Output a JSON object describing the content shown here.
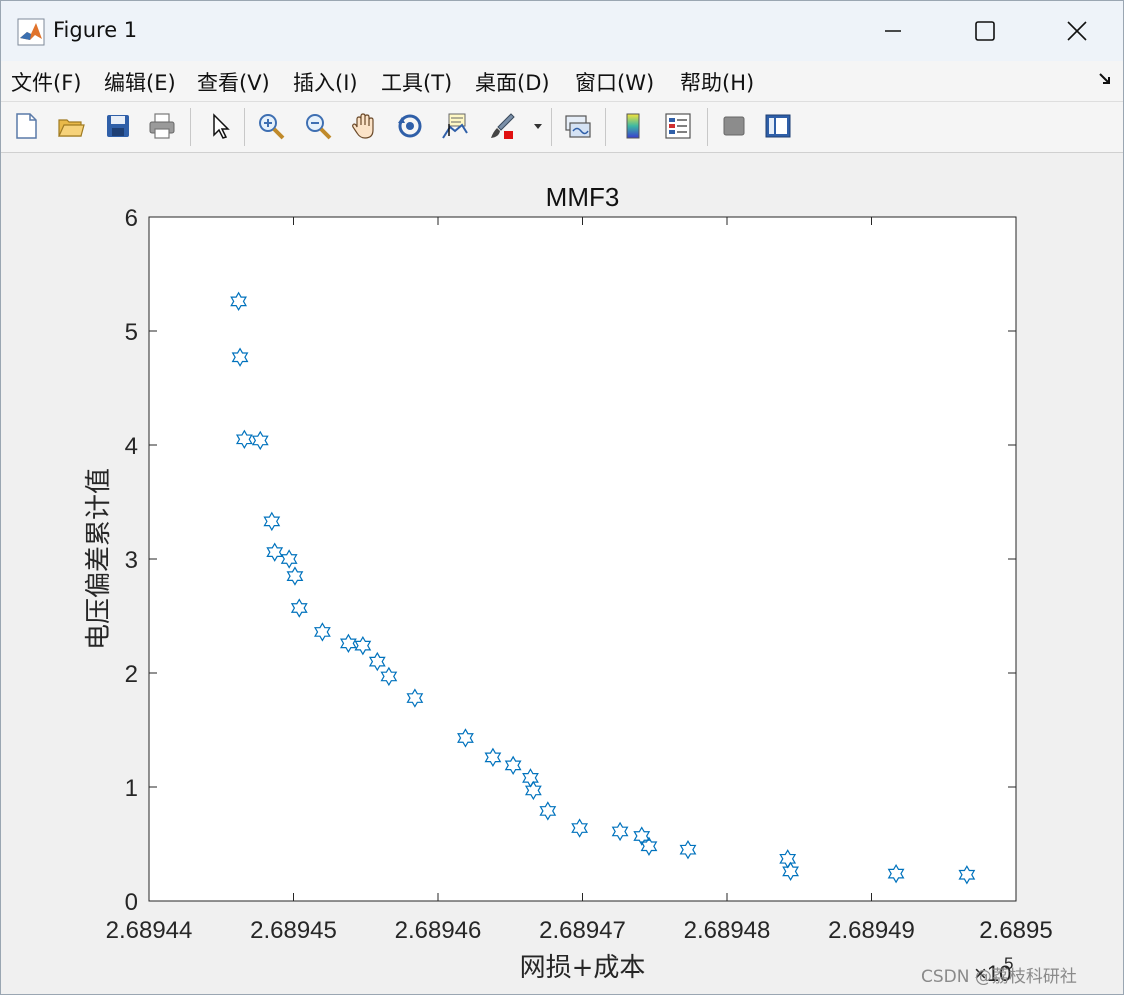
{
  "window": {
    "title": "Figure 1"
  },
  "menu": {
    "items": [
      "文件(F)",
      "编辑(E)",
      "查看(V)",
      "插入(I)",
      "工具(T)",
      "桌面(D)",
      "窗口(W)",
      "帮助(H)"
    ]
  },
  "toolbar": {
    "icons": [
      "new-figure-icon",
      "open-file-icon",
      "save-icon",
      "print-icon",
      "pointer-icon",
      "zoom-in-icon",
      "zoom-out-icon",
      "pan-hand-icon",
      "rotate-3d-icon",
      "data-cursor-icon",
      "brush-icon",
      "link-plot-icon",
      "colorbar-icon",
      "legend-icon",
      "hide-plot-tools-icon",
      "show-plot-tools-icon"
    ]
  },
  "watermark": "CSDN @荔枝科研社",
  "colors": {
    "marker": "#0072BD",
    "axes_bg": "#ffffff",
    "figure_bg": "#f0f0f0"
  },
  "chart_data": {
    "type": "scatter",
    "title": "MMF3",
    "xlabel": "网损+成本",
    "ylabel": "电压偏差累计值",
    "marker": "hexagram",
    "x_multiplier_label": "×10",
    "x_multiplier_exponent": "5",
    "xlim": [
      268944,
      268950
    ],
    "ylim": [
      0,
      6
    ],
    "xticks": [
      268944,
      268945,
      268946,
      268947,
      268948,
      268949,
      268950
    ],
    "xtick_labels": [
      "2.68944",
      "2.68945",
      "2.68946",
      "2.68947",
      "2.68948",
      "2.68949",
      "2.6895"
    ],
    "yticks": [
      0,
      1,
      2,
      3,
      4,
      5,
      6
    ],
    "ytick_labels": [
      "0",
      "1",
      "2",
      "3",
      "4",
      "5",
      "6"
    ],
    "grid": false,
    "series": [
      {
        "x": [
          268944.62,
          268944.63,
          268944.66,
          268944.77,
          268944.85,
          268944.87,
          268944.97,
          268945.01,
          268945.04,
          268945.2,
          268945.38,
          268945.48,
          268945.58,
          268945.66,
          268945.84,
          268946.19,
          268946.38,
          268946.52,
          268946.64,
          268946.66,
          268946.76,
          268946.98,
          268947.26,
          268947.41,
          268947.46,
          268947.73,
          268948.42,
          268948.44,
          268949.17,
          268949.66
        ],
        "y": [
          5.26,
          4.77,
          4.05,
          4.04,
          3.33,
          3.06,
          3.0,
          2.85,
          2.57,
          2.36,
          2.26,
          2.24,
          2.1,
          1.97,
          1.78,
          1.43,
          1.26,
          1.19,
          1.08,
          0.97,
          0.79,
          0.64,
          0.61,
          0.57,
          0.48,
          0.45,
          0.37,
          0.26,
          0.24,
          0.23
        ]
      }
    ]
  }
}
